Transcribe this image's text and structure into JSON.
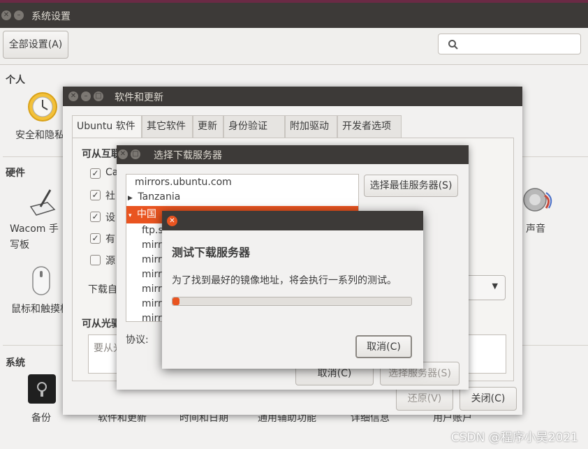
{
  "settings": {
    "title": "系统设置",
    "all_settings_label": "全部设置(A)",
    "sections": {
      "personal": "个人",
      "hardware": "硬件",
      "system": "系统"
    },
    "items": {
      "security": "安全和隐私",
      "wacom": "Wacom 手写板",
      "mouse": "鼠标和触摸板",
      "sound": "声音",
      "backup": "备份",
      "software": "软件和更新",
      "datetime": "时间和日期",
      "accessibility": "通用辅助功能",
      "details": "详细信息",
      "accounts": "用户账户"
    }
  },
  "software_updates": {
    "title": "软件和更新",
    "tabs": [
      "Ubuntu 软件",
      "其它软件",
      "更新",
      "身份验证",
      "附加驱动",
      "开发者选项"
    ],
    "internet_heading": "可从互联网下载",
    "checkbox_labels": [
      "Ca",
      "社",
      "设",
      "有",
      "源"
    ],
    "download_label": "下载自",
    "cdrom_heading": "可从光驱安装",
    "cdrom_placeholder": "要从光",
    "revert_label": "还原(V)",
    "close_label": "关闭(C)"
  },
  "mirror_dialog": {
    "title": "选择下载服务器",
    "tree": [
      "mirrors.ubuntu.com",
      "Tanzania",
      "中国",
      "ftp.s",
      "mirr",
      "mirr",
      "mirr",
      "mirr",
      "mirr",
      "mirr"
    ],
    "best_server_label": "选择最佳服务器(S)",
    "protocol_label": "协议:",
    "cancel_label": "取消(C)",
    "select_label": "选择服务器(S)"
  },
  "test_dialog": {
    "heading": "测试下载服务器",
    "message": "为了找到最好的镜像地址，将会执行一系列的测试。",
    "progress": 0.02,
    "cancel_label": "取消(C)"
  },
  "watermark": "CSDN @程序小吴2021",
  "colors": {
    "accent": "#e95420",
    "titlebar": "#3d3a38"
  }
}
